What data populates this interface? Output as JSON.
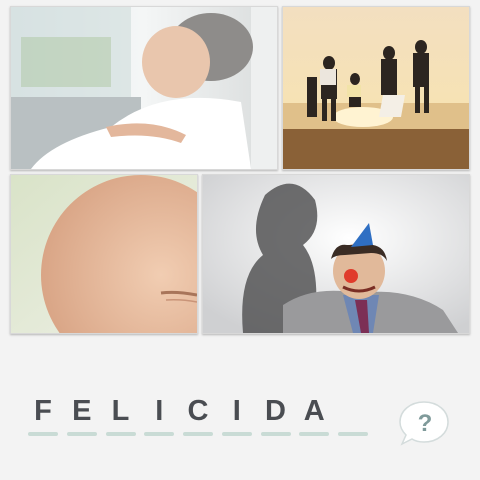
{
  "game": {
    "photos": [
      {
        "id": "senior-woman",
        "desc": "old-woman-photo"
      },
      {
        "id": "family-beach",
        "desc": "family-jumping-beach-photo"
      },
      {
        "id": "baby",
        "desc": "sleeping-baby-photo"
      },
      {
        "id": "clown",
        "desc": "clown-with-party-hat-photo"
      }
    ],
    "answer": {
      "letters": [
        "F",
        "E",
        "L",
        "I",
        "C",
        "I",
        "D",
        "A",
        "",
        ""
      ]
    },
    "hint_button": {
      "label": "?",
      "icon": "question-speech-bubble-icon"
    }
  },
  "colors": {
    "background": "#f3f3f3",
    "letter": "#4a4d52",
    "dash": "#c9dbd5",
    "hint_accent": "#7f9a9a"
  }
}
